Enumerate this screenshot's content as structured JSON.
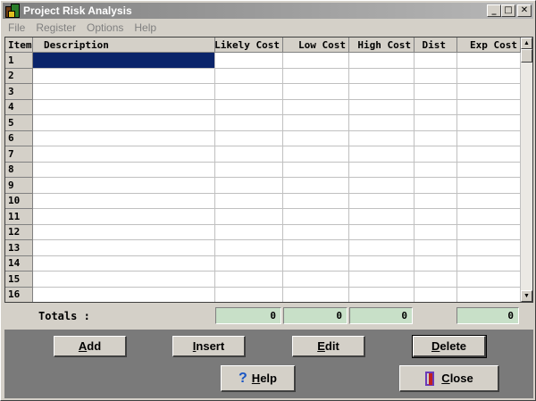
{
  "window": {
    "title": "Project Risk Analysis",
    "controls": {
      "minimize": "_",
      "maximize": "□",
      "close": "✕"
    }
  },
  "menu": [
    "File",
    "Register",
    "Options",
    "Help"
  ],
  "grid": {
    "columns": [
      "Item",
      "Description",
      "Likely Cost",
      "Low Cost",
      "High Cost",
      "Dist",
      "Exp Cost"
    ],
    "rows": [
      "1",
      "2",
      "3",
      "4",
      "5",
      "6",
      "7",
      "8",
      "9",
      "10",
      "11",
      "12",
      "13",
      "14",
      "15",
      "16"
    ],
    "selected": {
      "row": 1,
      "column": "Description"
    }
  },
  "totals": {
    "label": "Totals :",
    "likely": "0",
    "low": "0",
    "high": "0",
    "exp": "0"
  },
  "buttons": {
    "add": {
      "prefix": "",
      "ul": "A",
      "rest": "dd"
    },
    "insert": {
      "prefix": "",
      "ul": "I",
      "rest": "nsert"
    },
    "edit": {
      "prefix": "",
      "ul": "E",
      "rest": "dit"
    },
    "delete": {
      "prefix": "",
      "ul": "D",
      "rest": "elete"
    },
    "help": {
      "prefix": "",
      "ul": "H",
      "rest": "elp"
    },
    "close": {
      "prefix": "",
      "ul": "C",
      "rest": "lose"
    }
  },
  "icons": {
    "app": "project-risk-app-icon",
    "help": "question-mark-icon",
    "close": "exit-door-icon",
    "scroll_up": "scroll-up-arrow-icon",
    "scroll_down": "scroll-down-arrow-icon"
  },
  "colors": {
    "selection": "#0a246a",
    "total_field": "#c8e0c8",
    "bottom_panel": "#7a7a7a",
    "help_icon": "#1a56c4"
  }
}
